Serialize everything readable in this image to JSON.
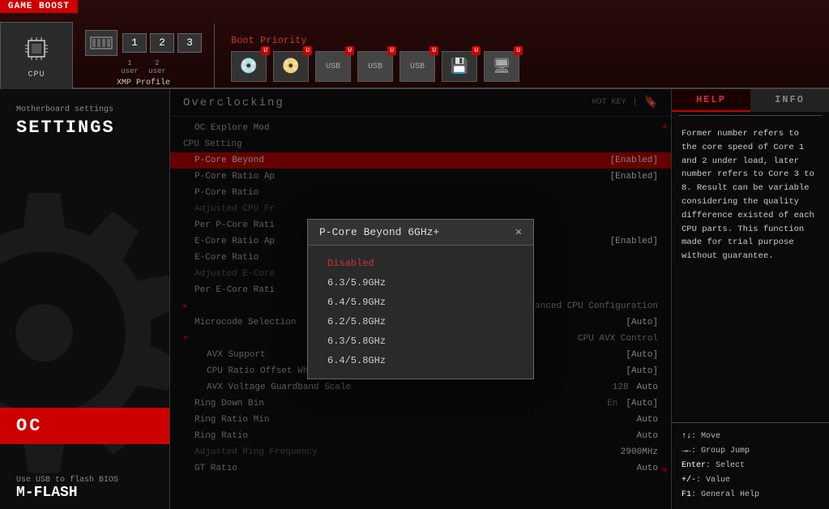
{
  "topbar": {
    "game_boost": "GAME BOOST",
    "tabs": [
      {
        "id": "cpu",
        "label": "CPU",
        "icon": "🖥",
        "active": true
      },
      {
        "id": "xmp",
        "label": "XMP Profile",
        "nums": [
          "1",
          "2",
          "3"
        ],
        "sub": [
          "1 user",
          "2 user"
        ]
      }
    ],
    "boot_priority": {
      "title": "Boot Priority",
      "devices": [
        {
          "icon": "💿",
          "badge": "U",
          "label": ""
        },
        {
          "icon": "📀",
          "badge": "U",
          "label": ""
        },
        {
          "icon": "USB",
          "badge": "U",
          "label": ""
        },
        {
          "icon": "USB",
          "badge": "U",
          "label": ""
        },
        {
          "icon": "USB",
          "badge": "U",
          "label": ""
        },
        {
          "icon": "💾",
          "badge": "U",
          "label": ""
        },
        {
          "icon": "📟",
          "badge": "U",
          "label": ""
        }
      ]
    }
  },
  "sidebar": {
    "settings_sub": "Motherboard settings",
    "settings_title": "SETTINGS",
    "active_item": "OC",
    "bottom_sub": "Use USB to flash BIOS",
    "bottom_title": "M-FLASH"
  },
  "content": {
    "title": "Overclocking",
    "hotkey": "HOT KEY",
    "scroll_up": "↑",
    "rows": [
      {
        "id": "oc-explore",
        "label": "OC Explore Mod",
        "value": "",
        "level": 1,
        "dimmed": false
      },
      {
        "id": "cpu-setting",
        "label": "CPU Setting",
        "value": "",
        "level": 0,
        "section": true
      },
      {
        "id": "p-core-beyond",
        "label": "P-Core Beyond",
        "value": "[Enabled]",
        "level": 1,
        "highlighted": true
      },
      {
        "id": "p-core-ratio-ap",
        "label": "P-Core Ratio Ap",
        "value": "[Enabled]",
        "level": 1
      },
      {
        "id": "p-core-ratio",
        "label": "P-Core Ratio",
        "value": "",
        "level": 1
      },
      {
        "id": "adjusted-cpu-f",
        "label": "Adjusted CPU Fr",
        "value": "",
        "level": 1,
        "dimmed": true
      },
      {
        "id": "per-p-core-rati",
        "label": "Per P-Core Rati",
        "value": "",
        "level": 1
      },
      {
        "id": "e-core-ratio-ap",
        "label": "E-Core Ratio Ap",
        "value": "[Enabled]",
        "level": 1
      },
      {
        "id": "e-core-ratio",
        "label": "E-Core Ratio",
        "value": "",
        "level": 1
      },
      {
        "id": "adjusted-e-core",
        "label": "Adjusted E-Core",
        "value": "",
        "level": 1,
        "dimmed": true
      },
      {
        "id": "per-e-core-rati",
        "label": "Per E-Core Rati",
        "value": "",
        "level": 1
      },
      {
        "id": "advanced-cpu",
        "label": "Advanced CPU Configuration",
        "value": "",
        "level": 0,
        "section": true,
        "collapsible": true
      },
      {
        "id": "microcode",
        "label": "Microcode Selection",
        "value": "[Auto]",
        "level": 1
      },
      {
        "id": "cpu-avx",
        "label": "CPU AVX Control",
        "value": "",
        "level": 0,
        "section": true,
        "collapsible": true,
        "collapsed": true
      },
      {
        "id": "avx-support",
        "label": "AVX Support",
        "value": "[Auto]",
        "level": 2
      },
      {
        "id": "cpu-ratio-offset",
        "label": "CPU Ratio Offset When Running AVX",
        "value": "[Auto]",
        "level": 2
      },
      {
        "id": "avx-voltage",
        "label": "AVX Voltage Guardband Scale",
        "value": "Auto",
        "level": 2,
        "extra": "128"
      },
      {
        "id": "ring-down-bin",
        "label": "Ring Down Bin",
        "value": "[Auto]",
        "level": 1,
        "extra2": "En"
      },
      {
        "id": "ring-ratio-min",
        "label": "Ring Ratio Min",
        "value": "Auto",
        "level": 1
      },
      {
        "id": "ring-ratio",
        "label": "Ring Ratio",
        "value": "Auto",
        "level": 1
      },
      {
        "id": "adj-ring-freq",
        "label": "Adjusted Ring Frequency",
        "value": "2900MHz",
        "level": 1,
        "dimmed": true
      },
      {
        "id": "gt-ratio",
        "label": "GT Ratio",
        "value": "Auto",
        "level": 1
      }
    ]
  },
  "modal": {
    "title": "P-Core Beyond 6GHz+",
    "close": "✕",
    "options": [
      {
        "id": "disabled",
        "label": "Disabled",
        "selected": true
      },
      {
        "id": "6.3-5.9",
        "label": "6.3/5.9GHz",
        "selected": false
      },
      {
        "id": "6.4-5.9",
        "label": "6.4/5.9GHz",
        "selected": false
      },
      {
        "id": "6.2-5.8",
        "label": "6.2/5.8GHz",
        "selected": false
      },
      {
        "id": "6.3-5.8",
        "label": "6.3/5.8GHz",
        "selected": false
      },
      {
        "id": "6.4-5.8",
        "label": "6.4/5.8GHz",
        "selected": false
      }
    ]
  },
  "help": {
    "active_tab": "HELP",
    "inactive_tab": "INFO",
    "text": "Former number refers to the core speed of Core 1 and 2 under load, later number refers to Core 3 to 8. Result can be variable considering the quality difference existed of each CPU parts. This function made for trial purpose without guarantee.",
    "nav": [
      {
        "key": "↑↓",
        "desc": ": Move"
      },
      {
        "key": "→←",
        "desc": ": Group Jump"
      },
      {
        "key": "Enter",
        "desc": ": Select"
      },
      {
        "key": "+/-",
        "desc": ": Value"
      },
      {
        "key": "F1",
        "desc": ": General Help"
      }
    ]
  }
}
